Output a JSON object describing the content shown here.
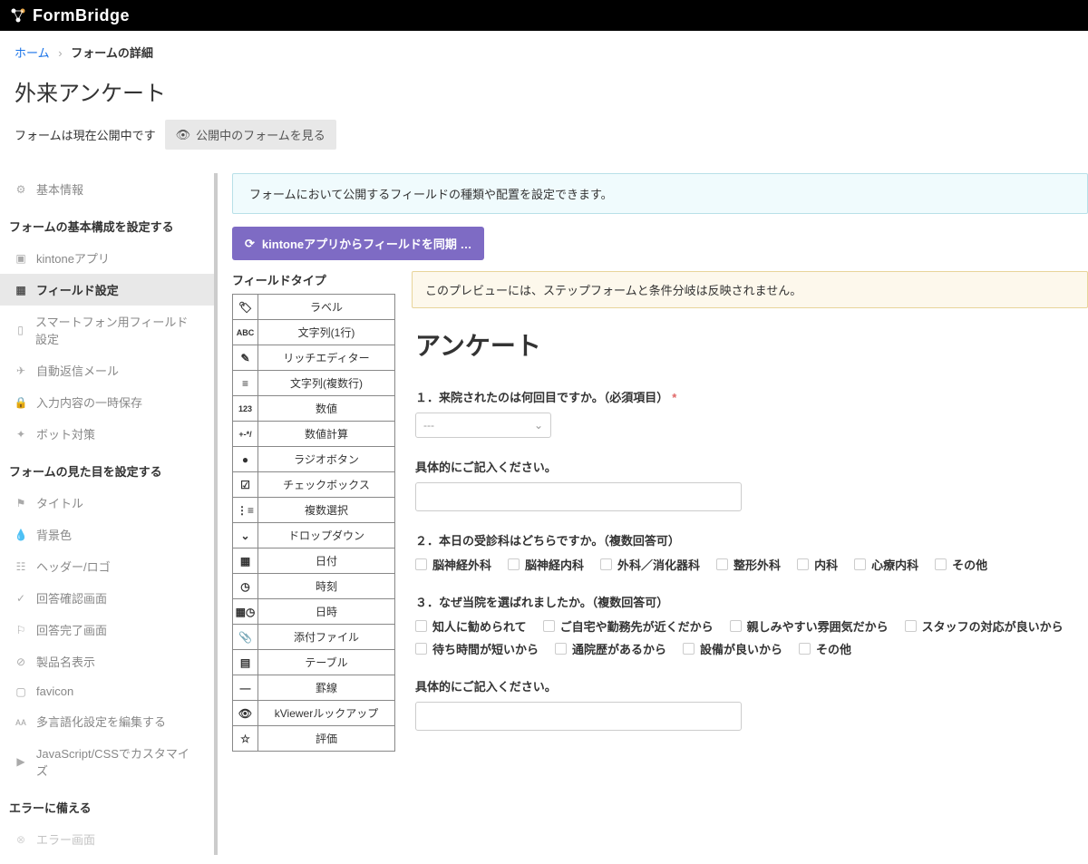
{
  "header": {
    "brand": "FormBridge"
  },
  "breadcrumb": {
    "home": "ホーム",
    "current": "フォームの詳細"
  },
  "page": {
    "title": "外来アンケート",
    "status_text": "フォームは現在公開中です",
    "view_button": "公開中のフォームを見る"
  },
  "sidebar": {
    "basic_info": "基本情報",
    "group1_title": "フォームの基本構成を設定する",
    "group1_items": [
      {
        "icon": "app",
        "label": "kintoneアプリ"
      },
      {
        "icon": "grid",
        "label": "フィールド設定",
        "active": true
      },
      {
        "icon": "phone",
        "label": "スマートフォン用フィールド設定"
      },
      {
        "icon": "send",
        "label": "自動返信メール"
      },
      {
        "icon": "lock",
        "label": "入力内容の一時保存"
      },
      {
        "icon": "bot",
        "label": "ボット対策"
      }
    ],
    "group2_title": "フォームの見た目を設定する",
    "group2_items": [
      {
        "icon": "flag",
        "label": "タイトル"
      },
      {
        "icon": "drop",
        "label": "背景色"
      },
      {
        "icon": "text",
        "label": "ヘッダー/ロゴ"
      },
      {
        "icon": "check",
        "label": "回答確認画面"
      },
      {
        "icon": "flag2",
        "label": "回答完了画面"
      },
      {
        "icon": "ban",
        "label": "製品名表示"
      },
      {
        "icon": "bookmark",
        "label": "favicon"
      },
      {
        "icon": "lang",
        "label": "多言語化設定を編集する"
      },
      {
        "icon": "code",
        "label": "JavaScript/CSSでカスタマイズ"
      }
    ],
    "group3_title": "エラーに備える",
    "group3_items": [
      {
        "icon": "err",
        "label": "エラー画面"
      }
    ]
  },
  "content": {
    "info_banner": "フォームにおいて公開するフィールドの種類や配置を設定できます。",
    "sync_button": "kintoneアプリからフィールドを同期 …",
    "field_types_title": "フィールドタイプ",
    "field_types": [
      {
        "icon": "🏷",
        "label": "ラベル"
      },
      {
        "icon": "ABC",
        "label": "文字列(1行)"
      },
      {
        "icon": "✎",
        "label": "リッチエディター"
      },
      {
        "icon": "≡",
        "label": "文字列(複数行)"
      },
      {
        "icon": "123",
        "label": "数値"
      },
      {
        "icon": "+-*/",
        "label": "数値計算"
      },
      {
        "icon": "●",
        "label": "ラジオボタン"
      },
      {
        "icon": "☑",
        "label": "チェックボックス"
      },
      {
        "icon": "⋮≡",
        "label": "複数選択"
      },
      {
        "icon": "⌄",
        "label": "ドロップダウン"
      },
      {
        "icon": "▦",
        "label": "日付"
      },
      {
        "icon": "◷",
        "label": "時刻"
      },
      {
        "icon": "▦◷",
        "label": "日時"
      },
      {
        "icon": "📎",
        "label": "添付ファイル"
      },
      {
        "icon": "▤",
        "label": "テーブル"
      },
      {
        "icon": "—",
        "label": "罫線"
      },
      {
        "icon": "👁",
        "label": "kViewerルックアップ"
      },
      {
        "icon": "☆",
        "label": "評価"
      }
    ],
    "warn_banner": "このプレビューには、ステップフォームと条件分岐は反映されません。"
  },
  "form": {
    "heading": "アンケート",
    "q1": {
      "label": "１．来院されたのは何回目ですか。（必須項目）",
      "placeholder": "---"
    },
    "q_detail": "具体的にご記入ください。",
    "q2": {
      "label": "２．本日の受診科はどちらですか。（複数回答可）",
      "options": [
        "脳神経外科",
        "脳神経内科",
        "外科／消化器科",
        "整形外科",
        "内科",
        "心療内科",
        "その他"
      ]
    },
    "q3": {
      "label": "３．なぜ当院を選ばれましたか。（複数回答可）",
      "options": [
        "知人に勧められて",
        "ご自宅や勤務先が近くだから",
        "親しみやすい雰囲気だから",
        "スタッフの対応が良いから",
        "待ち時間が短いから",
        "通院歴があるから",
        "設備が良いから",
        "その他"
      ]
    }
  }
}
